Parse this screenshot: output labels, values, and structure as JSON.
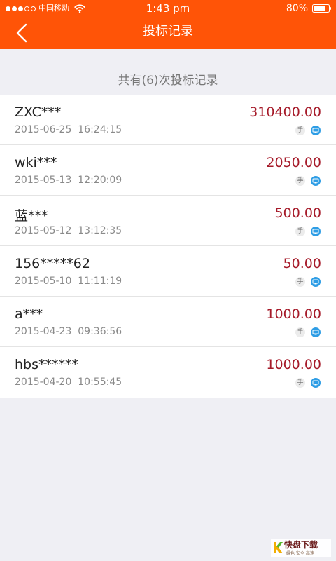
{
  "status_bar": {
    "carrier": "中国移动",
    "time": "1:43 pm",
    "battery_percent": "80%",
    "battery_level": 0.8,
    "signal_bars_filled": 3,
    "signal_bars_total": 5
  },
  "nav": {
    "title": "投标记录"
  },
  "summary": "共有(6)次投标记录",
  "records": [
    {
      "user": "ZXC***",
      "time": "2015-06-25  16:24:15",
      "amount": "310400.00",
      "mobile_label": "手"
    },
    {
      "user": "wki***",
      "time": "2015-05-13  12:20:09",
      "amount": "2050.00",
      "mobile_label": "手"
    },
    {
      "user": "蓝***",
      "time": "2015-05-12  13:12:35",
      "amount": "500.00",
      "mobile_label": "手"
    },
    {
      "user": "156*****62",
      "time": "2015-05-10  11:11:19",
      "amount": "50.00",
      "mobile_label": "手"
    },
    {
      "user": "a***",
      "time": "2015-04-23  09:36:56",
      "amount": "1000.00",
      "mobile_label": "手"
    },
    {
      "user": "hbs******",
      "time": "2015-04-20  10:55:45",
      "amount": "1000.00",
      "mobile_label": "手"
    }
  ],
  "watermark": {
    "brand": "快盘下载",
    "tagline": "绿色·安全·高速",
    "icon": "k-logo"
  },
  "colors": {
    "header": "#ff5407",
    "amount": "#a61b2a",
    "pc_icon": "#2e9de5",
    "background": "#efeff4"
  },
  "icons": {
    "back": "chevron-left-icon",
    "wifi": "wifi-icon",
    "battery": "battery-icon",
    "mobile": "mobile-device-icon",
    "pc": "desktop-icon"
  }
}
